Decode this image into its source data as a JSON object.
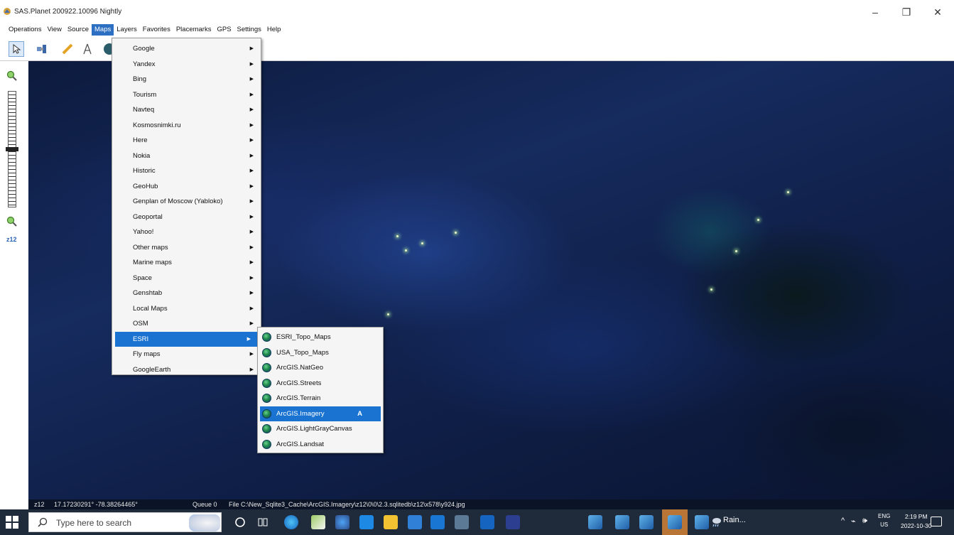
{
  "window": {
    "title": "SAS.Planet 200922.10096 Nightly",
    "controls": {
      "minimize": "–",
      "maximize": "❐",
      "close": "✕"
    }
  },
  "menubar": {
    "items": [
      "Operations",
      "View",
      "Source",
      "Maps",
      "Layers",
      "Favorites",
      "Placemarks",
      "GPS",
      "Settings",
      "Help"
    ],
    "active": "Maps"
  },
  "toolbar": {
    "icons": [
      "cursor-icon",
      "satellite-icon",
      "ruler-icon",
      "compass-icon",
      "globe-icon"
    ]
  },
  "zoom": {
    "label": "z12",
    "level": 12
  },
  "maps_menu": {
    "items": [
      {
        "label": "Google"
      },
      {
        "label": "Yandex"
      },
      {
        "label": "Bing"
      },
      {
        "label": "Tourism"
      },
      {
        "label": "Navteq"
      },
      {
        "label": "Kosmosnimki.ru"
      },
      {
        "label": "Here"
      },
      {
        "label": "Nokia"
      },
      {
        "label": "Historic"
      },
      {
        "label": "GeoHub"
      },
      {
        "label": "Genplan of Moscow (Yabloko)"
      },
      {
        "label": "Geoportal"
      },
      {
        "label": "Yahoo!"
      },
      {
        "label": "Other maps"
      },
      {
        "label": "Marine maps"
      },
      {
        "label": "Space"
      },
      {
        "label": "Genshtab"
      },
      {
        "label": "Local Maps"
      },
      {
        "label": "OSM"
      },
      {
        "label": "ESRI"
      },
      {
        "label": "Fly maps"
      },
      {
        "label": "GoogleEarth"
      }
    ],
    "highlighted": "ESRI",
    "arrow": "▶"
  },
  "esri_submenu": {
    "items": [
      {
        "label": "ESRI_Topo_Maps",
        "shortcut": ""
      },
      {
        "label": "USA_Topo_Maps",
        "shortcut": ""
      },
      {
        "label": "ArcGIS.NatGeo",
        "shortcut": ""
      },
      {
        "label": "ArcGIS.Streets",
        "shortcut": ""
      },
      {
        "label": "ArcGIS.Terrain",
        "shortcut": ""
      },
      {
        "label": "ArcGIS.Imagery",
        "shortcut": "A"
      },
      {
        "label": "ArcGIS.LightGrayCanvas",
        "shortcut": ""
      },
      {
        "label": "ArcGIS.Landsat",
        "shortcut": ""
      }
    ],
    "highlighted": "ArcGIS.Imagery"
  },
  "statusbar": {
    "zoom": "z12",
    "coords": "17.17230291° -78.38264465°",
    "queue": "Queue 0",
    "file": "File C:\\New_Sqlite3_Cache\\ArcGIS.Imagery\\z12\\0\\0\\2.3.sqlitedb\\z12\\x578\\y924.jpg"
  },
  "taskbar": {
    "search_placeholder": "Type here to search",
    "weather": "Rain...",
    "lang_top": "ENG",
    "lang_bottom": "US",
    "time": "2:19 PM",
    "date": "2022-10-30",
    "colors": {
      "background": "#1f2b3a",
      "highlight": "#b87535",
      "selection": "#1a73d1"
    }
  }
}
